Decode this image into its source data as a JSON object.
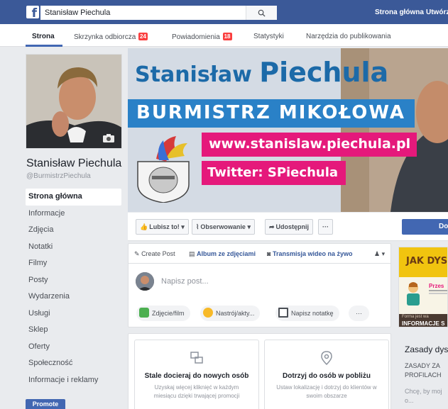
{
  "topbar": {
    "logo": "f",
    "search_value": "Stanisław Piechula",
    "links": [
      "Strona główna",
      "Utwórz"
    ]
  },
  "tabs": [
    {
      "label": "Strona",
      "badge": ""
    },
    {
      "label": "Skrzynka odbiorcza",
      "badge": "24"
    },
    {
      "label": "Powiadomienia",
      "badge": "18"
    },
    {
      "label": "Statystyki",
      "badge": ""
    },
    {
      "label": "Narzędzia do publikowania",
      "badge": ""
    }
  ],
  "profile": {
    "name": "Stanisław Piechula",
    "handle": "@BurmistrzPiechula"
  },
  "sidebar": {
    "items": [
      {
        "label": "Strona główna"
      },
      {
        "label": "Informacje"
      },
      {
        "label": "Zdjęcia"
      },
      {
        "label": "Notatki"
      },
      {
        "label": "Filmy"
      },
      {
        "label": "Posty"
      },
      {
        "label": "Wydarzenia"
      },
      {
        "label": "Usługi"
      },
      {
        "label": "Sklep"
      },
      {
        "label": "Oferty"
      },
      {
        "label": "Społeczność"
      },
      {
        "label": "Informacje i reklamy"
      }
    ],
    "promote_label": "Promote"
  },
  "cover": {
    "name_part1": "Stanisław",
    "name_part2": "Piechula",
    "subtitle": "BURMISTRZ MIKOŁOWA",
    "website": "www.stanislaw.piechula.pl",
    "twitter": "Twitter: SPiechula"
  },
  "actions": {
    "like": "Lubisz to!",
    "follow": "Obserwowanie",
    "share": "Udostępnij",
    "more": "···",
    "primary": "Do"
  },
  "composer": {
    "tabs": [
      "Create Post",
      "Album ze zdjęciami",
      "Transmisja wideo na żywo"
    ],
    "placeholder": "Napisz post...",
    "chips": [
      "Zdjęcie/film",
      "Nastrój/akty...",
      "Napisz notatkę",
      "···"
    ]
  },
  "promos": [
    {
      "title": "Stale docieraj do nowych osób",
      "desc": "Uzyskaj więcej kliknięć w każdym miesiącu dzięki trwającej promocji"
    },
    {
      "title": "Dotrzyj do osób w pobliżu",
      "desc": "Ustaw lokalizację i dotrzyj do klientów w swoim obszarze"
    }
  ],
  "right": {
    "banner": "JAK DYS",
    "przes": "Przes",
    "forma": "Forma jest wa",
    "info": "INFORMACJE S",
    "title": "Zasady dys",
    "line1": "ZASADY ZA",
    "line2": "PROFILACH",
    "line3": "Chcę, by moj",
    "line4": "o..."
  },
  "colors": {
    "fb_blue": "#3b5998",
    "button_blue": "#4267b2",
    "cover_blue": "#2a81c7",
    "cover_pink": "#e5197b",
    "badge_red": "#fa3e3e"
  }
}
